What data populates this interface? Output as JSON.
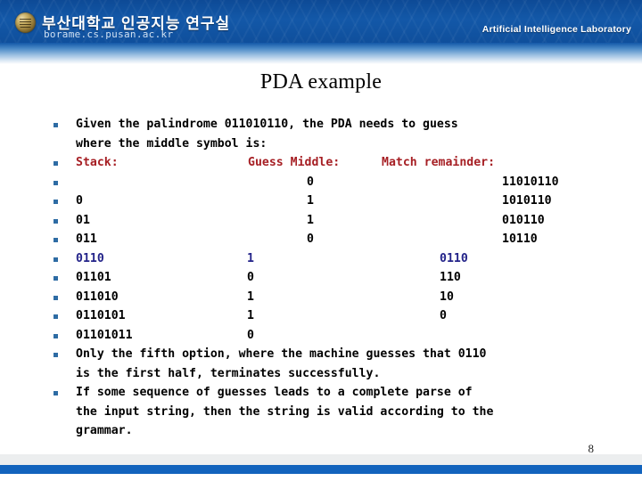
{
  "header": {
    "university_name": "부산대학교 인공지능 연구실",
    "url": "borame.cs.pusan.ac.kr",
    "lab_name": "Artificial Intelligence Laboratory",
    "emblem_icon": "university-seal-icon",
    "background_color": "#1358a8"
  },
  "slide": {
    "title": "PDA example",
    "page_number": "8"
  },
  "colors": {
    "bullet": "#2e6ca4",
    "header_row": "#a61f24",
    "highlight_row": "#232389",
    "normal_text": "#000000",
    "footer_bar": "#1263bd"
  },
  "content": {
    "intro": {
      "line1": "Given the palindrome 011010110, the PDA needs to guess",
      "line2": "where the middle symbol is:"
    },
    "table_headers": {
      "stack": "Stack:",
      "guess_middle": "Guess Middle:",
      "match_remainder": "Match remainder:"
    },
    "rows_group_a": [
      {
        "stack": "",
        "guess": "0",
        "remainder": "11010110"
      },
      {
        "stack": "0",
        "guess": "1",
        "remainder": "1010110"
      },
      {
        "stack": "01",
        "guess": "1",
        "remainder": "010110"
      },
      {
        "stack": "011",
        "guess": "0",
        "remainder": "10110"
      }
    ],
    "rows_group_b": [
      {
        "stack": "0110",
        "guess": "1",
        "remainder": "0110",
        "highlight": true
      },
      {
        "stack": "01101",
        "guess": "0",
        "remainder": "110",
        "highlight": false
      },
      {
        "stack": "011010",
        "guess": "1",
        "remainder": "10",
        "highlight": false
      },
      {
        "stack": "0110101",
        "guess": "1",
        "remainder": "0",
        "highlight": false
      },
      {
        "stack": "01101011",
        "guess": "0",
        "remainder": "",
        "highlight": false
      }
    ],
    "conclusion1": {
      "line1": "Only the fifth option, where the machine guesses that 0110",
      "line2": "is the first half, terminates successfully."
    },
    "conclusion2": {
      "line1": "If some sequence of guesses leads to a complete parse of",
      "line2": "the input string, then the string is valid according to the",
      "line3": "grammar."
    }
  }
}
